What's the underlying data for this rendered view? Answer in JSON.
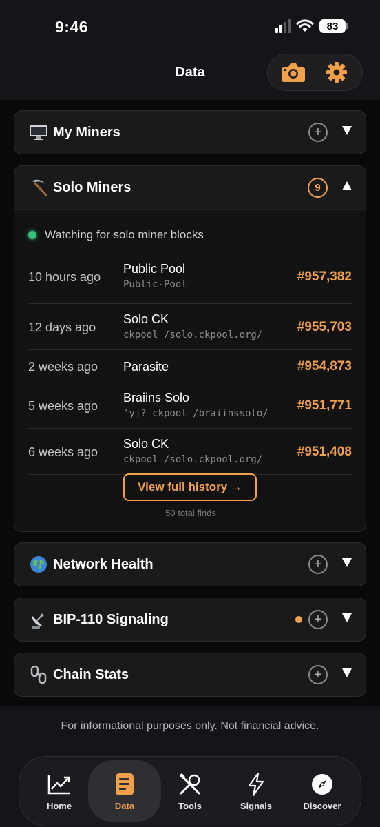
{
  "status": {
    "time": "9:46",
    "battery": "83"
  },
  "header": {
    "title": "Data",
    "camera_icon": "camera-icon",
    "settings_icon": "gear-icon"
  },
  "cards": {
    "my_miners": {
      "title": "My Miners",
      "icon": "computer-icon"
    },
    "solo_miners": {
      "title": "Solo Miners",
      "icon": "pickaxe-icon",
      "badge": "9",
      "watching": "Watching for solo miner blocks",
      "rows": [
        {
          "ago": "10 hours ago",
          "name": "Public Pool",
          "sub": "Public-Pool",
          "block": "#957,382"
        },
        {
          "ago": "12 days ago",
          "name": "Solo CK",
          "sub": "ckpool /solo.ckpool.org/",
          "block": "#955,703"
        },
        {
          "ago": "2 weeks ago",
          "name": "Parasite",
          "sub": "",
          "block": "#954,873"
        },
        {
          "ago": "5 weeks ago",
          "name": "Braiins Solo",
          "sub": "'yj? ckpool /braiinssolo/",
          "block": "#951,771"
        },
        {
          "ago": "6 weeks ago",
          "name": "Solo CK",
          "sub": "ckpool /solo.ckpool.org/",
          "block": "#951,408"
        }
      ],
      "history_button": "View full history →",
      "total_finds": "50 total finds"
    },
    "network_health": {
      "title": "Network Health",
      "icon": "globe-icon"
    },
    "bip110": {
      "title": "BIP-110 Signaling",
      "icon": "satellite-dish-icon"
    },
    "chain_stats": {
      "title": "Chain Stats",
      "icon": "chain-link-icon"
    }
  },
  "footer": {
    "disclaimer": "For informational purposes only. Not financial advice."
  },
  "tabs": [
    {
      "label": "Home",
      "icon": "chart-trend-icon"
    },
    {
      "label": "Data",
      "icon": "document-icon"
    },
    {
      "label": "Tools",
      "icon": "tools-icon"
    },
    {
      "label": "Signals",
      "icon": "lightning-icon"
    },
    {
      "label": "Discover",
      "icon": "compass-icon"
    }
  ],
  "colors": {
    "accent": "#f0a04b",
    "live": "#37c07a",
    "card": "#1a1a1b",
    "background": "#0a0a0a"
  }
}
